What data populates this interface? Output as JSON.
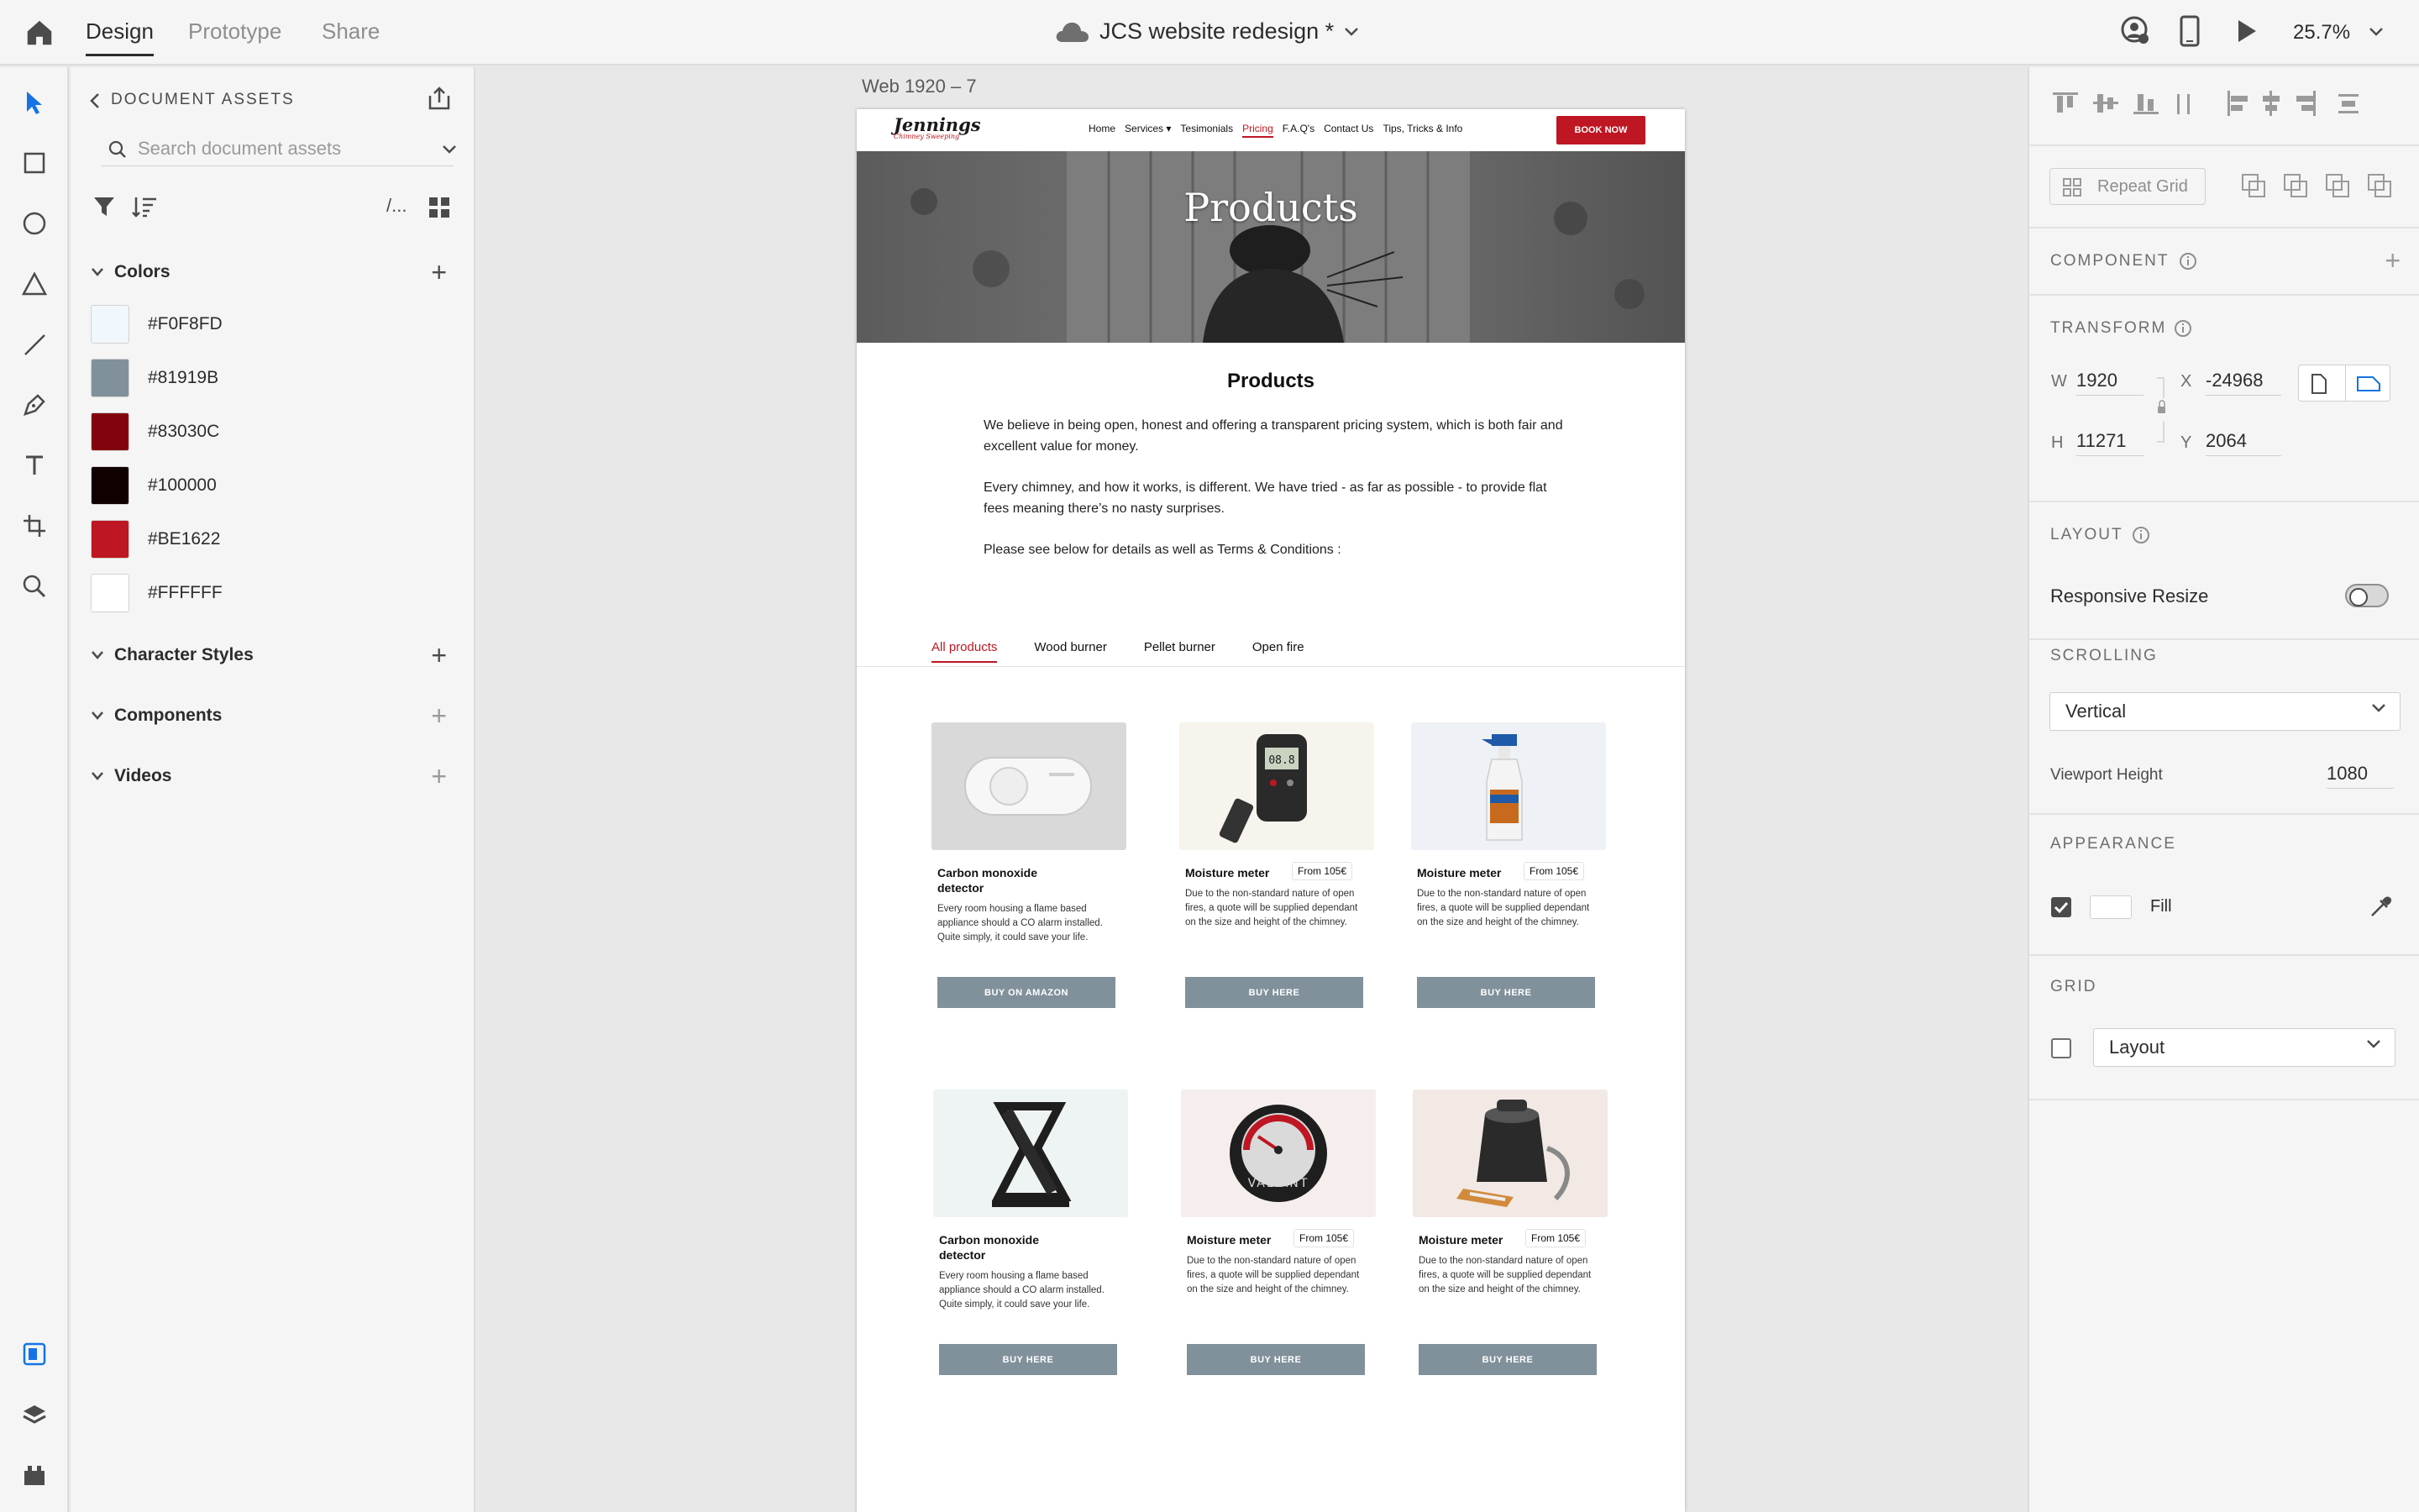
{
  "app": {
    "modes": [
      "Design",
      "Prototype",
      "Share"
    ],
    "document_title": "JCS website redesign *",
    "zoom": "25.7%"
  },
  "assets": {
    "header": "DOCUMENT ASSETS",
    "search_placeholder": "Search document assets",
    "view_toggle": "/...",
    "colors_label": "Colors",
    "colors": [
      {
        "hex": "#F0F8FD",
        "label": "#F0F8FD"
      },
      {
        "hex": "#81919B",
        "label": "#81919B"
      },
      {
        "hex": "#83030C",
        "label": "#83030C"
      },
      {
        "hex": "#100000",
        "label": "#100000"
      },
      {
        "hex": "#BE1622",
        "label": "#BE1622"
      },
      {
        "hex": "#FFFFFF",
        "label": "#FFFFFF"
      }
    ],
    "character_styles_label": "Character Styles",
    "components_label": "Components",
    "videos_label": "Videos"
  },
  "artboard": {
    "label": "Web 1920 – 7",
    "nav": {
      "logo": "Jennings",
      "logo_sub": "Chimney Sweeping",
      "links": [
        "Home",
        "Services ▾",
        "Tesimonials",
        "Pricing",
        "F.A.Q's",
        "Contact Us",
        "Tips, Tricks & Info"
      ],
      "book_now": "BOOK NOW"
    },
    "hero_title": "Products",
    "content_title": "Products",
    "paragraphs": [
      "We believe in being open, honest and offering a transparent pricing system, which is both fair and excellent value for money.",
      "Every chimney, and how it works, is different. We have tried - as far as possible - to provide flat fees meaning there’s no nasty surprises.",
      "Please see below for details as well as Terms & Conditions :"
    ],
    "tabs": [
      "All products",
      "Wood burner",
      "Pellet burner",
      "Open fire"
    ],
    "products": [
      {
        "name": "Carbon monoxide detector",
        "price": "",
        "desc": "Every room housing a flame based appliance should a CO alarm installed. Quite simply, it could save your life.",
        "button": "BUY ON AMAZON"
      },
      {
        "name": "Moisture meter",
        "price": "From 105€",
        "desc": "Due to the non-standard nature of open fires, a quote will be supplied dependant on the size and height of the chimney.",
        "button": "BUY HERE"
      },
      {
        "name": "Moisture meter",
        "price": "From 105€",
        "desc": "Due to the non-standard nature of open fires, a quote will be supplied dependant on the size and height of the chimney.",
        "button": "BUY HERE"
      },
      {
        "name": "Carbon monoxide detector",
        "price": "",
        "desc": "Every room housing a flame based appliance should a CO alarm installed. Quite simply, it could save your life.",
        "button": "BUY HERE"
      },
      {
        "name": "Moisture meter",
        "price": "From 105€",
        "desc": "Due to the non-standard nature of open fires, a quote will be supplied dependant on the size and height of the chimney.",
        "button": "BUY HERE"
      },
      {
        "name": "Moisture meter",
        "price": "From 105€",
        "desc": "Due to the non-standard nature of open fires, a quote will be supplied dependant on the size and height of the chimney.",
        "button": "BUY HERE"
      }
    ],
    "meter_display": "08.8",
    "gauge_label": "VALIANT"
  },
  "properties": {
    "repeat_grid": "Repeat Grid",
    "component_label": "COMPONENT",
    "transform_label": "TRANSFORM",
    "w_label": "W",
    "w": "1920",
    "x_label": "X",
    "x": "-24968",
    "h_label": "H",
    "h": "11271",
    "y_label": "Y",
    "y": "2064",
    "layout_label": "LAYOUT",
    "responsive_resize": "Responsive Resize",
    "responsive_resize_on": false,
    "scrolling_label": "SCROLLING",
    "scrolling_value": "Vertical",
    "viewport_height_label": "Viewport Height",
    "viewport_height": "1080",
    "appearance_label": "APPEARANCE",
    "fill_label": "Fill",
    "fill_checked": true,
    "grid_label": "GRID",
    "grid_value": "Layout",
    "grid_checked": false
  }
}
